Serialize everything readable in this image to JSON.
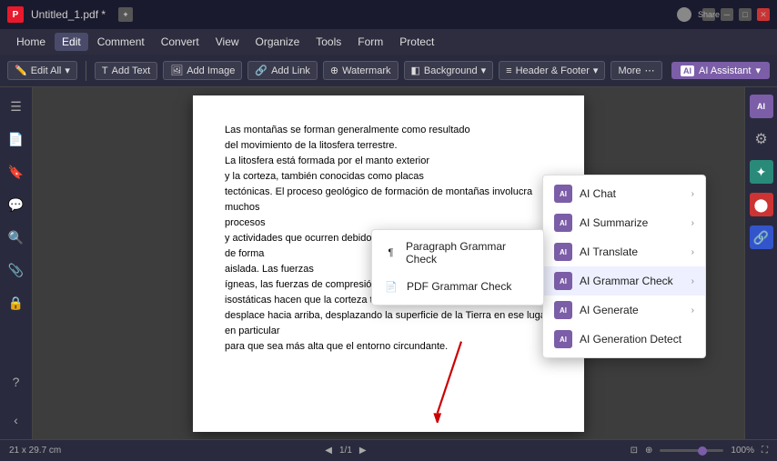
{
  "titleBar": {
    "title": "Untitled_1.pdf *",
    "newTabLabel": "+"
  },
  "menuBar": {
    "items": [
      "Home",
      "Edit",
      "Comment",
      "Convert",
      "View",
      "Organize",
      "Tools",
      "Form",
      "Protect"
    ]
  },
  "toolbar": {
    "editAll": "Edit All",
    "editAllDropdown": "▾",
    "addText": "Add Text",
    "addImage": "Add Image",
    "addLink": "Add Link",
    "watermark": "Watermark",
    "background": "Background",
    "headerFooter": "Header & Footer",
    "more": "More",
    "aiAssistant": "AI Assistant"
  },
  "sidebarLeft": {
    "icons": [
      "☰",
      "📄",
      "🔖",
      "✏️",
      "🔍",
      "📎",
      "🔒"
    ]
  },
  "pdfContent": {
    "text": "Las montañas se forman generalmente como resultado\ndel movimiento de la litosfera terrestre.\nLa litosfera está formada por el manto exterior\ny la corteza, también conocidas como placas\ntectónicas. El proceso geológico de formación de montañas involucra muchos\nprocesos\ny actividades que ocurren debido a muchas fuerzas que actúan juntas o de forma\naislada. Las fuerzas\nígneas, las fuerzas de compresión y las fuerzas\nisostáticas hacen que la corteza terrestre se\ndesplace hacia arriba, desplazando la superficie de la Tierra en ese lugar en particular\npara que sea más alta que el entorno circundante."
  },
  "aiDropdown": {
    "items": [
      {
        "id": "ai-chat",
        "label": "AI Chat",
        "hasArrow": true
      },
      {
        "id": "ai-summarize",
        "label": "AI Summarize",
        "hasArrow": true
      },
      {
        "id": "ai-translate",
        "label": "AI Translate",
        "hasArrow": true
      },
      {
        "id": "ai-grammar-check",
        "label": "AI Grammar Check",
        "hasArrow": true,
        "highlighted": true
      },
      {
        "id": "ai-generate",
        "label": "AI Generate",
        "hasArrow": true
      },
      {
        "id": "ai-generation-detect",
        "label": "AI Generation Detect",
        "hasArrow": false
      }
    ]
  },
  "grammarDropdown": {
    "items": [
      {
        "id": "paragraph-grammar",
        "label": "Paragraph Grammar Check",
        "icon": "¶"
      },
      {
        "id": "pdf-grammar",
        "label": "PDF Grammar Check",
        "icon": "📄"
      }
    ]
  },
  "statusBar": {
    "dimensions": "21 x 29.7 cm",
    "pageInfo": "1/1",
    "zoomLevel": "100%"
  }
}
